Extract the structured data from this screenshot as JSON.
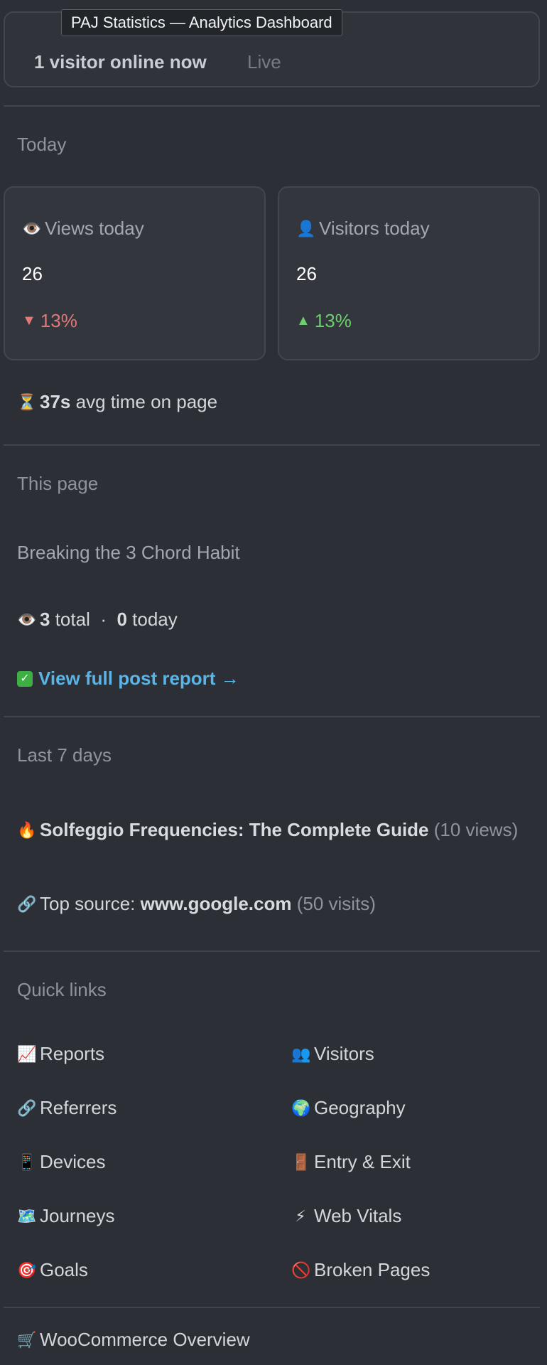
{
  "tooltip": "PAJ Statistics — Analytics Dashboard",
  "online": {
    "text": "1 visitor online now",
    "live": "Live"
  },
  "today": {
    "title": "Today",
    "views": {
      "icon": "eye-icon",
      "glyph": "👁️",
      "label": "Views today",
      "value": "26",
      "change": "13%",
      "direction": "down"
    },
    "visitors": {
      "icon": "person-icon",
      "glyph": "👤",
      "label": "Visitors today",
      "value": "26",
      "change": "13%",
      "direction": "up"
    },
    "avg_time": {
      "glyph": "⏳",
      "value": "37s",
      "text": "avg time on page"
    }
  },
  "this_page": {
    "title": "This page",
    "post_title": "Breaking the 3 Chord Habit",
    "glyph": "👁️",
    "total_value": "3",
    "total_label": "total",
    "separator": "·",
    "today_value": "0",
    "today_label": "today",
    "report_link": "View full post report →"
  },
  "last7": {
    "title": "Last 7 days",
    "top_post_glyph": "🔥",
    "top_post": "Solfeggio Frequencies: The Complete Guide",
    "top_post_views": "(10 views)",
    "source_glyph": "🔗",
    "source_label": "Top source:",
    "source_value": "www.google.com",
    "source_visits": "(50 visits)"
  },
  "quick_links": {
    "title": "Quick links",
    "items": [
      {
        "glyph": "📈",
        "label": "Reports"
      },
      {
        "glyph": "👥",
        "label": "Visitors"
      },
      {
        "glyph": "🔗",
        "label": "Referrers"
      },
      {
        "glyph": "🌍",
        "label": "Geography"
      },
      {
        "glyph": "📱",
        "label": "Devices"
      },
      {
        "glyph": "🚪",
        "label": "Entry & Exit"
      },
      {
        "glyph": "🗺️",
        "label": "Journeys"
      },
      {
        "glyph": "⚡",
        "label": "Web Vitals"
      },
      {
        "glyph": "🎯",
        "label": "Goals"
      },
      {
        "glyph": "🚫",
        "label": "Broken Pages"
      }
    ]
  },
  "woo": {
    "glyph": "🛒",
    "label": "WooCommerce Overview"
  },
  "colors": {
    "down": "#e07a7a",
    "up": "#6ccf6c",
    "link": "#5ab4e6"
  }
}
